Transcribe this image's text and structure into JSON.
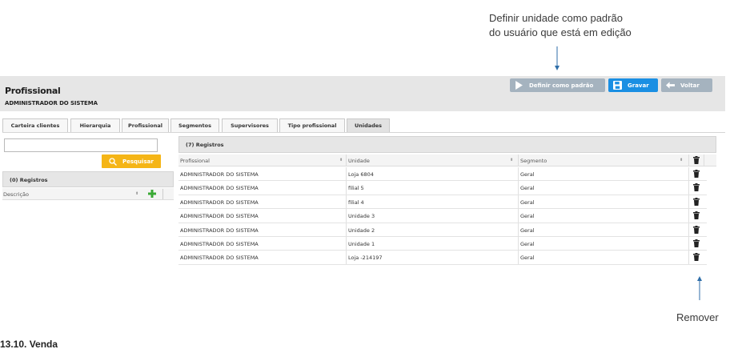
{
  "annotations": {
    "set_default_line1": "Definir unidade como padrão",
    "set_default_line2": "do usuário que está em edição",
    "remove": "Remover",
    "next_section_heading": "13.10. Venda"
  },
  "page": {
    "title": "Profissional",
    "subtitle": "ADMINISTRADOR DO SISTEMA"
  },
  "toolbar": {
    "set_default_label": "Definir como padrão",
    "save_label": "Gravar",
    "back_label": "Voltar"
  },
  "tabs": [
    {
      "label": "Carteira clientes"
    },
    {
      "label": "Hierarquia"
    },
    {
      "label": "Profissional"
    },
    {
      "label": "Segmentos"
    },
    {
      "label": "Supervisores"
    },
    {
      "label": "Tipo profissional"
    },
    {
      "label": "Unidades",
      "active": true
    }
  ],
  "left_panel": {
    "search_value": "",
    "search_button": "Pesquisar",
    "records_label": "(0) Registros",
    "column_label": "Descrição"
  },
  "grid": {
    "records_label": "(7) Registros",
    "columns": [
      "Profissional",
      "Unidade",
      "Segmento"
    ],
    "rows": [
      {
        "profissional": "ADMINISTRADOR DO SISTEMA",
        "unidade": "Loja 6804",
        "segmento": "Geral"
      },
      {
        "profissional": "ADMINISTRADOR DO SISTEMA",
        "unidade": "filial 5",
        "segmento": "Geral"
      },
      {
        "profissional": "ADMINISTRADOR DO SISTEMA",
        "unidade": "filial 4",
        "segmento": "Geral"
      },
      {
        "profissional": "ADMINISTRADOR DO SISTEMA",
        "unidade": "Unidade 3",
        "segmento": "Geral"
      },
      {
        "profissional": "ADMINISTRADOR DO SISTEMA",
        "unidade": "Unidade 2",
        "segmento": "Geral"
      },
      {
        "profissional": "ADMINISTRADOR DO SISTEMA",
        "unidade": "Unidade 1",
        "segmento": "Geral"
      },
      {
        "profissional": "ADMINISTRADOR DO SISTEMA",
        "unidade": "Loja -214197",
        "segmento": "Geral"
      }
    ]
  },
  "icons": {
    "default": "play-icon",
    "save": "floppy-disk-icon",
    "back": "arrow-left-icon",
    "search": "search-icon",
    "add": "plus-icon",
    "delete": "trash-icon",
    "sort": "sort-arrows-icon"
  },
  "colors": {
    "save_button": "#1a8fe3",
    "secondary_button": "#a5b3bf",
    "search_button": "#f5b516",
    "add_icon": "#3aa935",
    "annotation_arrow": "#2f6ea8"
  }
}
